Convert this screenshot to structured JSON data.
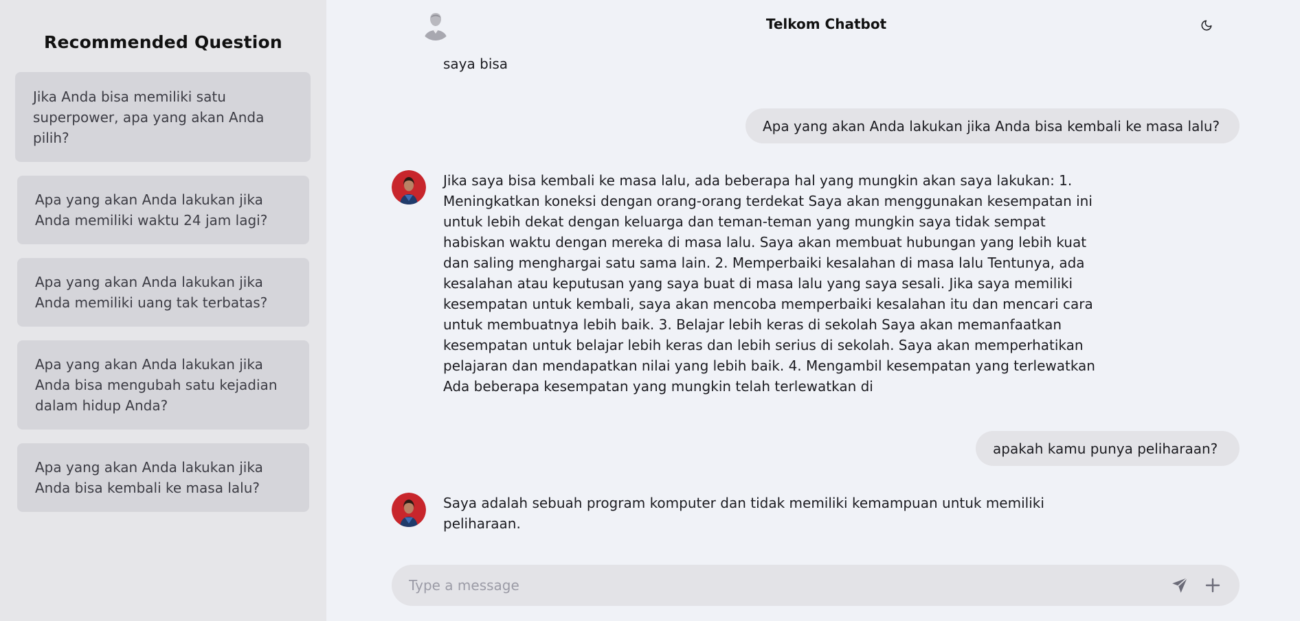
{
  "sidebar": {
    "title": "Recommended Question",
    "questions": [
      [
        "Jika Anda bisa memiliki satu",
        "superpower, apa yang akan Anda",
        "pilih?"
      ],
      [
        "Apa yang akan Anda lakukan jika",
        "Anda memiliki waktu 24 jam lagi?"
      ],
      [
        "Apa yang akan Anda lakukan jika",
        "Anda memiliki uang tak terbatas?"
      ],
      [
        "Apa yang akan Anda lakukan jika",
        "Anda bisa mengubah satu kejadian",
        "dalam hidup Anda?"
      ],
      [
        "Apa yang akan Anda lakukan jika",
        "Anda bisa kembali ke masa lalu?"
      ]
    ]
  },
  "header": {
    "title": "Telkom Chatbot",
    "avatar_icon": "user-silhouette-icon",
    "theme_icon": "moon-icon"
  },
  "chat": {
    "partial_bot_message": "saya bisa",
    "messages": [
      {
        "role": "user",
        "text": "Apa yang akan Anda lakukan jika Anda bisa kembali ke masa lalu?"
      },
      {
        "role": "bot",
        "lines": [
          "Jika saya bisa kembali ke masa lalu, ada beberapa hal yang mungkin akan saya lakukan: 1.",
          "Meningkatkan koneksi dengan orang-orang terdekat Saya akan menggunakan kesempatan ini",
          "untuk lebih dekat dengan keluarga dan teman-teman yang mungkin saya tidak sempat",
          "habiskan waktu dengan mereka di masa lalu. Saya akan membuat hubungan yang lebih kuat",
          "dan saling menghargai satu sama lain. 2. Memperbaiki kesalahan di masa lalu Tentunya, ada",
          "kesalahan atau keputusan yang saya buat di masa lalu yang saya sesali. Jika saya memiliki",
          "kesempatan untuk kembali, saya akan mencoba memperbaiki kesalahan itu dan mencari cara",
          "untuk membuatnya lebih baik. 3. Belajar lebih keras di sekolah Saya akan memanfaatkan",
          "kesempatan untuk belajar lebih keras dan lebih serius di sekolah. Saya akan memperhatikan",
          "pelajaran dan mendapatkan nilai yang lebih baik. 4. Mengambil kesempatan yang terlewatkan",
          "Ada beberapa kesempatan yang mungkin telah terlewatkan di"
        ]
      },
      {
        "role": "user",
        "text": "apakah kamu punya peliharaan?"
      },
      {
        "role": "bot",
        "lines": [
          "Saya adalah sebuah program komputer dan tidak memiliki kemampuan untuk memiliki",
          "peliharaan."
        ]
      }
    ]
  },
  "input": {
    "placeholder": "Type a message",
    "value": "",
    "send_icon": "send-icon",
    "add_icon": "plus-icon"
  },
  "colors": {
    "background": "#f0f2f7",
    "sidebar": "#e6e6e9",
    "card": "#d5d5da",
    "bubble": "#e3e3e7",
    "icon": "#6b6b78"
  }
}
